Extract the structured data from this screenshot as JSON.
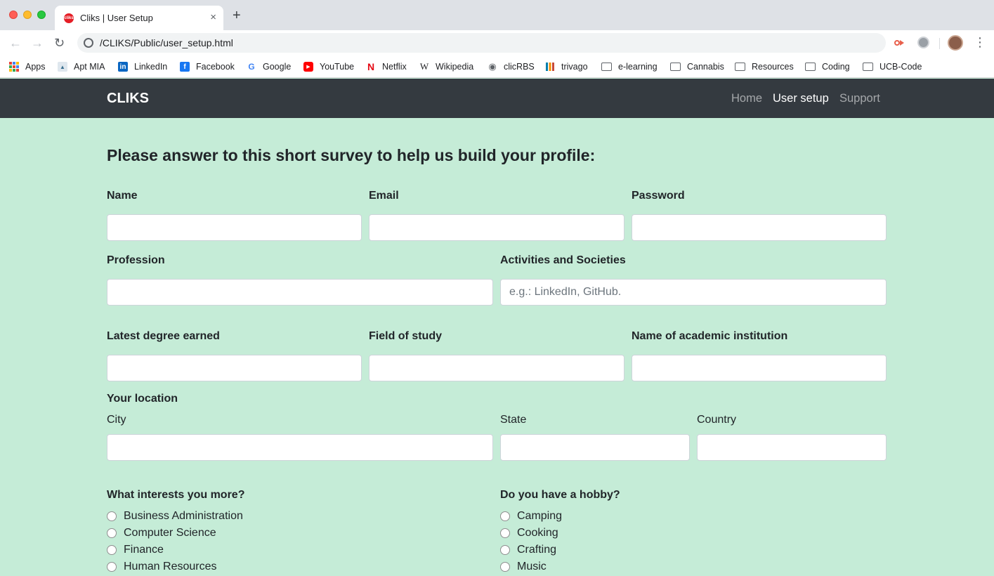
{
  "browser": {
    "tab_title": "Cliks | User Setup",
    "favicon_text": "cliks",
    "close_glyph": "×",
    "new_tab_glyph": "+",
    "url": "/CLIKS/Public/user_setup.html",
    "back_glyph": "←",
    "forward_glyph": "→",
    "reload_glyph": "↻",
    "menu_glyph": "⋮",
    "bookmarks": [
      {
        "label": "Apps",
        "icon": "apps-grid-icon"
      },
      {
        "label": "Apt MIA",
        "icon": "apt-mia-icon"
      },
      {
        "label": "LinkedIn",
        "icon": "linkedin-icon",
        "color": "#0a66c2",
        "glyph": "in"
      },
      {
        "label": "Facebook",
        "icon": "facebook-icon",
        "color": "#1877f2",
        "glyph": "f"
      },
      {
        "label": "Google",
        "icon": "google-icon",
        "color": "#4285f4",
        "glyph": "G"
      },
      {
        "label": "YouTube",
        "icon": "youtube-icon",
        "color": "#ff0000",
        "glyph": "▶"
      },
      {
        "label": "Netflix",
        "icon": "netflix-icon",
        "color": "#e50914",
        "glyph": "N"
      },
      {
        "label": "Wikipedia",
        "icon": "wikipedia-icon",
        "glyph": "W"
      },
      {
        "label": "clicRBS",
        "icon": "globe-icon",
        "glyph": "◉"
      },
      {
        "label": "trivago",
        "icon": "trivago-icon"
      },
      {
        "label": "e-learning",
        "icon": "folder-icon"
      },
      {
        "label": "Cannabis",
        "icon": "folder-icon"
      },
      {
        "label": "Resources",
        "icon": "folder-icon"
      },
      {
        "label": "Coding",
        "icon": "folder-icon"
      },
      {
        "label": "UCB-Code",
        "icon": "folder-icon"
      }
    ]
  },
  "navbar": {
    "brand": "CLIKS",
    "links": [
      {
        "label": "Home",
        "active": false
      },
      {
        "label": "User setup",
        "active": true
      },
      {
        "label": "Support",
        "active": false
      }
    ]
  },
  "form": {
    "heading": "Please answer to this short survey to help us build your profile:",
    "name_label": "Name",
    "email_label": "Email",
    "password_label": "Password",
    "profession_label": "Profession",
    "activities_label": "Activities and Societies",
    "activities_placeholder": "e.g.: LinkedIn, GitHub.",
    "degree_label": "Latest degree earned",
    "field_label": "Field of study",
    "institution_label": "Name of academic institution",
    "location_label": "Your location",
    "city_label": "City",
    "state_label": "State",
    "country_label": "Country",
    "interests_label": "What interests you more?",
    "interests": [
      "Business Administration",
      "Computer Science",
      "Finance",
      "Human Resources"
    ],
    "hobby_label": "Do you have a hobby?",
    "hobbies": [
      "Camping",
      "Cooking",
      "Crafting",
      "Music"
    ]
  },
  "colors": {
    "page_background": "#c5ecd7",
    "navbar_background": "#343a40",
    "text": "#212529"
  }
}
